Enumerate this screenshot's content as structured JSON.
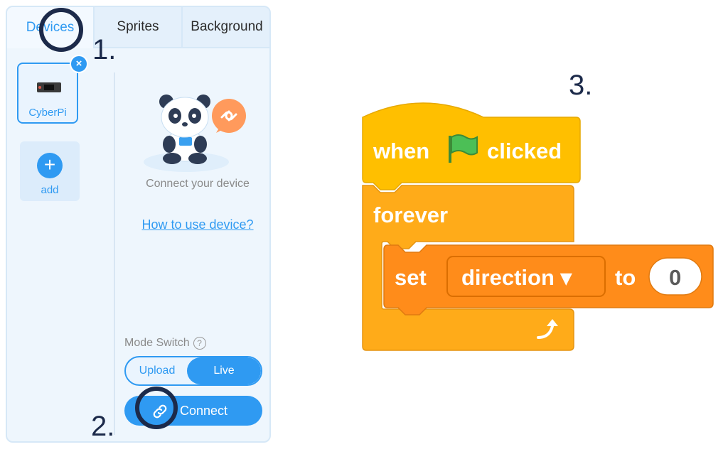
{
  "tabs": [
    {
      "label": "Devices"
    },
    {
      "label": "Sprites"
    },
    {
      "label": "Background"
    }
  ],
  "devices": {
    "device_label": "CyberPi",
    "add_label": "add"
  },
  "main": {
    "connect_text": "Connect your device",
    "howto_link": "How to use device?",
    "mode_switch_label": "Mode Switch",
    "toggle_upload": "Upload",
    "toggle_live": "Live",
    "connect_button": "Connect"
  },
  "annotations": {
    "step1": "1.",
    "step2": "2.",
    "step3": "3."
  },
  "blocks": {
    "when": "when",
    "clicked": "clicked",
    "forever": "forever",
    "set": "set",
    "dropdown": "direction ▾",
    "to": "to",
    "value": "0"
  },
  "colors": {
    "accent": "#2f9af2",
    "hat_block": "#ffbf00",
    "control_block": "#ffab19",
    "motion_block": "#ff8c1a",
    "annotation": "#1c2a4a"
  }
}
